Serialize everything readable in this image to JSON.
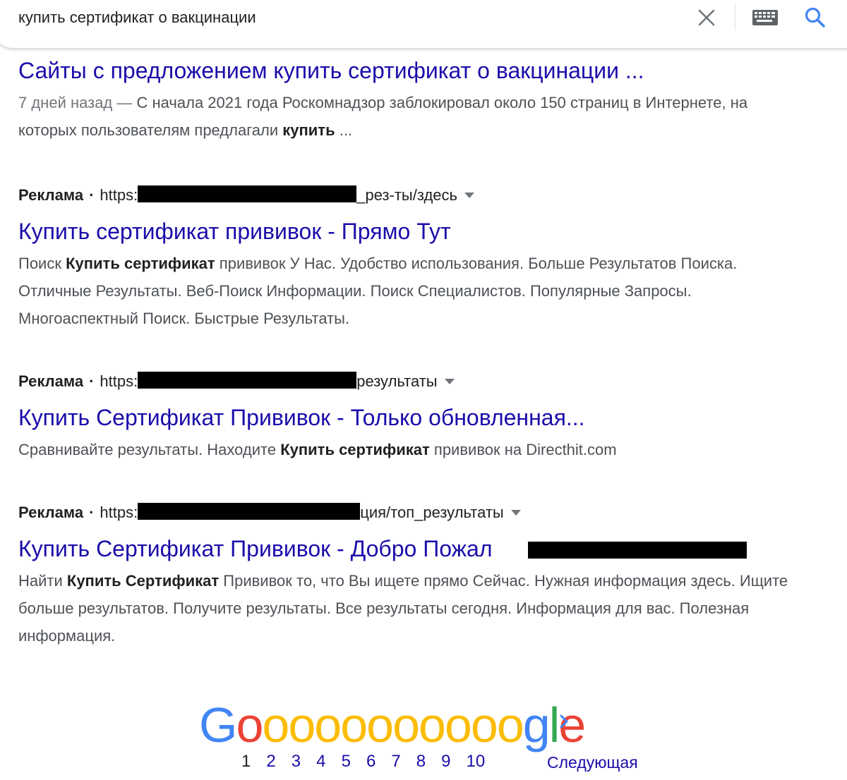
{
  "search": {
    "query": "купить сертификат о вакцинации"
  },
  "results": [
    {
      "title": "Сайты с предложением купить сертификат о вакцинации ...",
      "date": "7 дней назад —",
      "snippet_a": " С начала 2021 года Роскомнадзор заблокировал около 150 страниц в Интернете, на которых пользователям предлагали ",
      "snippet_b": "купить",
      "snippet_c": " ..."
    }
  ],
  "ads": [
    {
      "label": "Реклама",
      "url_start": "https:",
      "url_end": "_рез-ты/здесь",
      "title": "Купить сертификат прививок - Прямо Тут",
      "snippet_a": "Поиск ",
      "snippet_b": "Купить сертификат",
      "snippet_c": " прививок У Нас. Удобство использования. Больше Результатов Поиска. Отличные Результаты. Веб-Поиск Информации. Поиск Специалистов. Популярные Запросы. Многоаспектный Поиск. Быстрые Результаты."
    },
    {
      "label": "Реклама",
      "url_start": "https:",
      "url_end": "результаты",
      "title": "Купить Сертификат Прививок - Только обновленная...",
      "snippet_a": "Сравнивайте результаты. Находите ",
      "snippet_b": "Купить сертификат",
      "snippet_c": " прививок на Directhit.com"
    },
    {
      "label": "Реклама",
      "url_start": "https:",
      "url_end": "ция/топ_результаты",
      "title": "Купить Сертификат Прививок - Добро Пожал",
      "snippet_a": "Найти ",
      "snippet_b": "Купить Сертификат",
      "snippet_c": " Прививок то, что Вы ищете прямо Сейчас. Нужная информация здесь. Ищите больше результатов. Получите результаты. Все результаты сегодня. Информация для вас. Полезная информация."
    }
  ],
  "pagination": {
    "logo_letters": [
      "G",
      "o",
      "o",
      "o",
      "o",
      "o",
      "o",
      "o",
      "o",
      "o",
      "o",
      "o",
      "g",
      "l",
      "e"
    ],
    "logo_colors": [
      "#4285F4",
      "#EA4335",
      "#FBBC05",
      "#FBBC05",
      "#FBBC05",
      "#FBBC05",
      "#FBBC05",
      "#FBBC05",
      "#FBBC05",
      "#FBBC05",
      "#FBBC05",
      "#FBBC05",
      "#4285F4",
      "#34A853",
      "#EA4335"
    ],
    "pages": [
      "1",
      "2",
      "3",
      "4",
      "5",
      "6",
      "7",
      "8",
      "9",
      "10"
    ],
    "current": "1",
    "next_label": "Следующая"
  },
  "colors": {
    "link": "#1a0dab",
    "snippet": "#4d5156",
    "icon_blue": "#4285F4"
  },
  "icons": [
    "close-icon",
    "keyboard-icon",
    "search-icon",
    "dropdown-caret-icon",
    "chevron-right-icon"
  ]
}
